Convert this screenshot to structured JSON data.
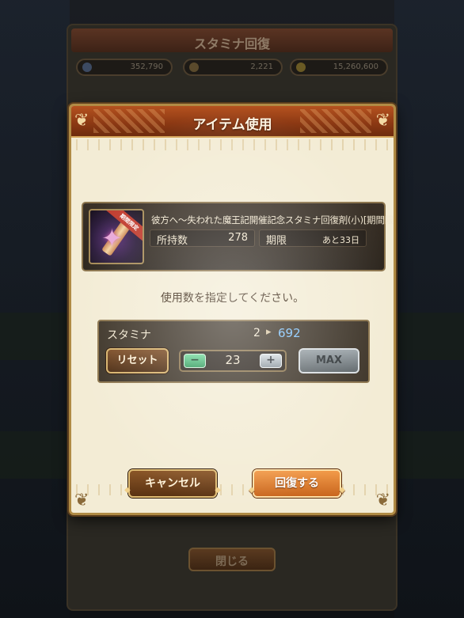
{
  "background": {
    "screen_title": "スタミナ回復",
    "currencies": [
      "352,790",
      "2,221",
      "15,260,600"
    ],
    "close_label": "閉じる"
  },
  "dialog": {
    "title": "アイテム使用",
    "item": {
      "name": "彼方へ～失われた魔王記開催記念スタミナ回復剤(小)[期間限定]",
      "badge": "期間限定",
      "owned_label": "所持数",
      "owned_value": "278",
      "limit_label": "期限",
      "limit_value": "あと33日",
      "icon": "stamina-potion-icon"
    },
    "instruction": "使用数を指定してください。",
    "stamina": {
      "label": "スタミナ",
      "current": "2",
      "arrow": "▸",
      "after": "692"
    },
    "controls": {
      "reset_label": "リセット",
      "minus_label": "−",
      "quantity": "23",
      "plus_label": "+",
      "max_label": "MAX"
    },
    "cancel_label": "キャンセル",
    "confirm_label": "回復する"
  },
  "colors": {
    "header": "#8e3a14",
    "parchment": "#f3ecd5",
    "accent_blue": "#7fc4ff",
    "confirm_orange": "#f29b4a"
  }
}
